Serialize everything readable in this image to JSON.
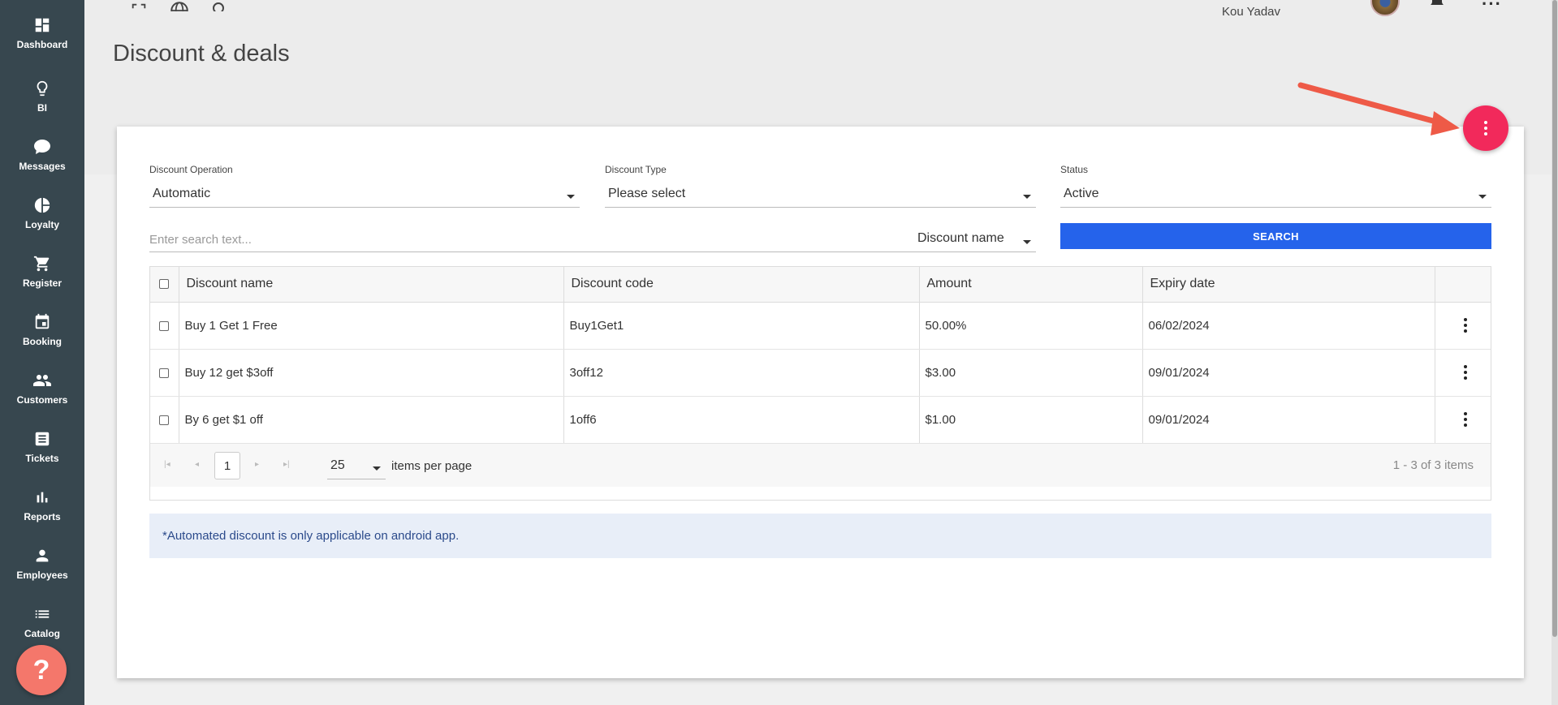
{
  "sidebar": {
    "items": [
      {
        "label": "Dashboard",
        "icon": "dashboard-icon"
      },
      {
        "label": "BI",
        "icon": "lightbulb-icon"
      },
      {
        "label": "Messages",
        "icon": "chat-icon"
      },
      {
        "label": "Loyalty",
        "icon": "pie-icon"
      },
      {
        "label": "Register",
        "icon": "cart-icon"
      },
      {
        "label": "Booking",
        "icon": "calendar-icon"
      },
      {
        "label": "Customers",
        "icon": "people-icon"
      },
      {
        "label": "Tickets",
        "icon": "receipt-icon"
      },
      {
        "label": "Reports",
        "icon": "bar-chart-icon"
      },
      {
        "label": "Employees",
        "icon": "person-icon"
      },
      {
        "label": "Catalog",
        "icon": "list-icon"
      }
    ],
    "help_label": "?"
  },
  "header": {
    "user_name": "Kou Yadav",
    "page_title": "Discount & deals"
  },
  "filters": {
    "operation_label": "Discount Operation",
    "operation_value": "Automatic",
    "type_label": "Discount Type",
    "type_value": "Please select",
    "status_label": "Status",
    "status_value": "Active"
  },
  "search": {
    "placeholder": "Enter search text...",
    "field_value": "Discount name",
    "button_label": "SEARCH"
  },
  "table": {
    "columns": [
      "Discount name",
      "Discount code",
      "Amount",
      "Expiry date"
    ],
    "rows": [
      {
        "name": "Buy 1 Get 1 Free",
        "code": "Buy1Get1",
        "amount": "50.00%",
        "expiry": "06/02/2024"
      },
      {
        "name": "Buy 12 get $3off",
        "code": "3off12",
        "amount": "$3.00",
        "expiry": "09/01/2024"
      },
      {
        "name": "By 6 get $1 off",
        "code": "1off6",
        "amount": "$1.00",
        "expiry": "09/01/2024"
      }
    ]
  },
  "pager": {
    "page": "1",
    "per_page": "25",
    "per_page_label": "items per page",
    "info": "1 - 3 of 3 items"
  },
  "notice": "*Automated discount is only applicable on android app.",
  "colors": {
    "sidebar": "#37474f",
    "fab": "#f2295b",
    "search_button": "#2563eb",
    "help": "#f4776b",
    "annotation_arrow": "#ee5a47"
  }
}
